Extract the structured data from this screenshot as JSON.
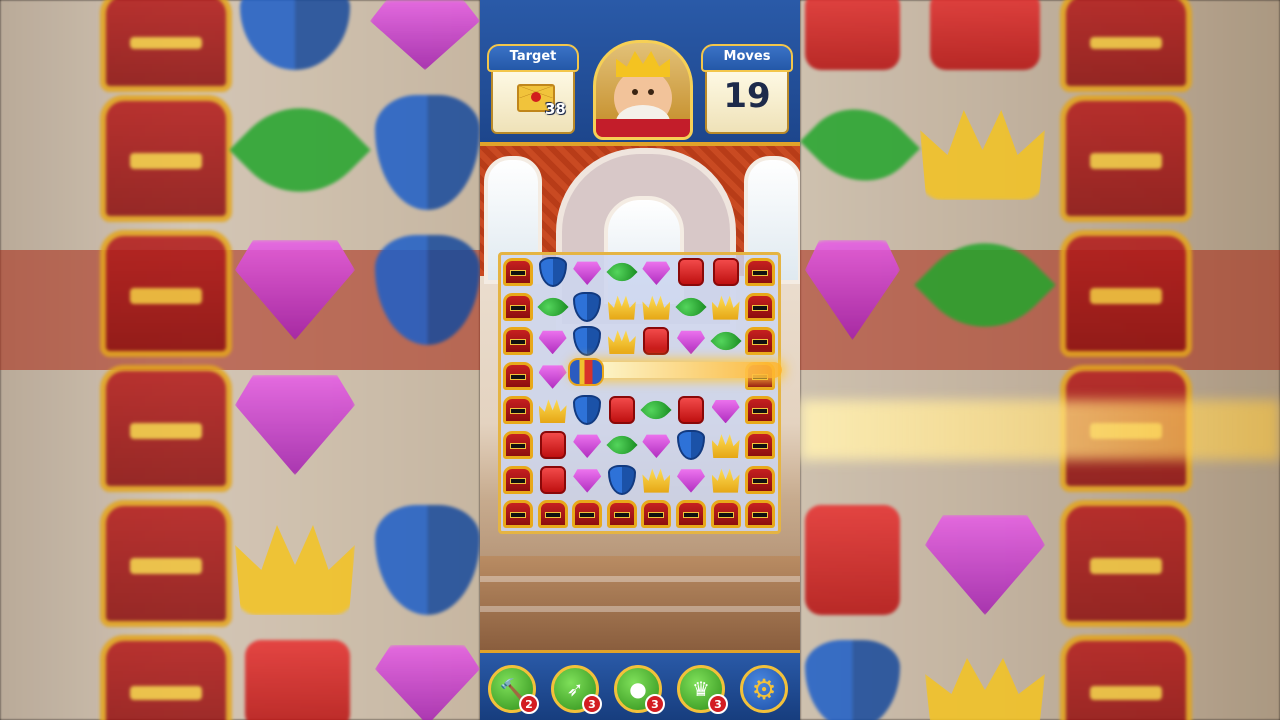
{
  "hud": {
    "target_label": "Target",
    "target_icon": "envelope-icon",
    "target_count": "38",
    "moves_label": "Moves",
    "moves_value": "19",
    "avatar_icon": "king-avatar-icon"
  },
  "board": {
    "rows": [
      [
        "chest",
        "shield",
        "gem",
        "leaf",
        "gem",
        "red",
        "red",
        "chest"
      ],
      [
        "chest",
        "leaf",
        "shield",
        "crown",
        "crown",
        "leaf",
        "crown",
        "chest"
      ],
      [
        "chest",
        "gem",
        "shield",
        "crown",
        "red",
        "gem",
        "leaf",
        "chest"
      ],
      [
        "chest",
        "gem",
        "rocket",
        "beam",
        "beam",
        "beam",
        "beam",
        "chest"
      ],
      [
        "chest",
        "crown",
        "shield",
        "red",
        "leaf",
        "red",
        "gem",
        "chest"
      ],
      [
        "chest",
        "red",
        "gem",
        "leaf",
        "gem",
        "shield",
        "crown",
        "chest"
      ],
      [
        "chest",
        "red",
        "gem",
        "shield",
        "crown",
        "gem",
        "crown",
        "chest"
      ],
      [
        "chest",
        "chest",
        "chest",
        "chest",
        "chest",
        "chest",
        "chest",
        "chest"
      ]
    ]
  },
  "boosters": [
    {
      "name": "hammer-booster",
      "icon": "hammer-icon",
      "count": "2"
    },
    {
      "name": "arrow-booster",
      "icon": "arrow-icon",
      "count": "3"
    },
    {
      "name": "cannon-booster",
      "icon": "cannon-icon",
      "count": "3"
    },
    {
      "name": "jester-booster",
      "icon": "jester-hat-icon",
      "count": "3"
    }
  ],
  "settings_icon": "gear-icon",
  "colors": {
    "hud_blue": "#2a5aa8",
    "gold_border": "#e1a32a",
    "badge_red": "#d31d22"
  }
}
